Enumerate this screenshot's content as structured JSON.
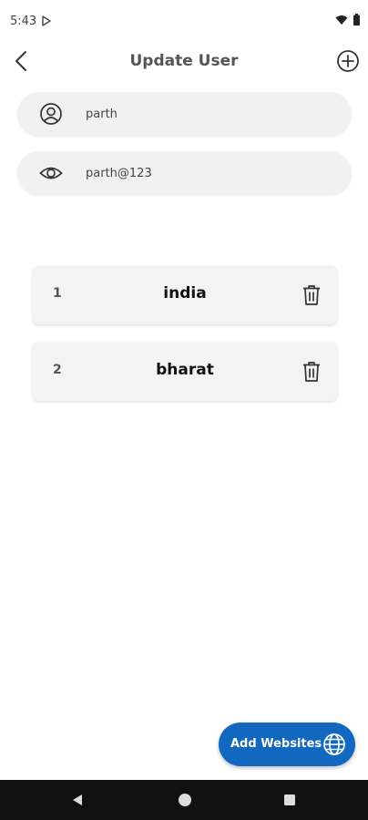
{
  "status_bar": {
    "time": "5:43"
  },
  "app_bar": {
    "title": "Update User"
  },
  "fields": {
    "username": {
      "value": "parth",
      "icon": "user-circle-icon"
    },
    "password": {
      "value": "parth@123",
      "icon": "eye-icon"
    }
  },
  "websites": [
    {
      "index": "1",
      "name": "india"
    },
    {
      "index": "2",
      "name": "bharat"
    }
  ],
  "fab": {
    "label": "Add Websites",
    "icon": "globe-icon",
    "color": "#1268bf"
  }
}
